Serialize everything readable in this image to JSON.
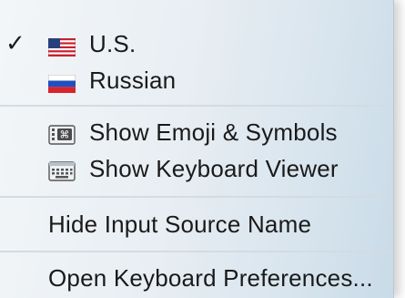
{
  "menu": {
    "input_sources": [
      {
        "label": "U.S.",
        "checked": true,
        "icon": "us-flag-icon"
      },
      {
        "label": "Russian",
        "checked": false,
        "icon": "russia-flag-icon"
      }
    ],
    "check_mark": "✓",
    "tools": [
      {
        "label": "Show Emoji & Symbols",
        "icon": "emoji-symbols-icon"
      },
      {
        "label": "Show Keyboard Viewer",
        "icon": "keyboard-viewer-icon"
      }
    ],
    "hide_input_source_name": "Hide Input Source Name",
    "open_keyboard_preferences": "Open Keyboard Preferences..."
  }
}
